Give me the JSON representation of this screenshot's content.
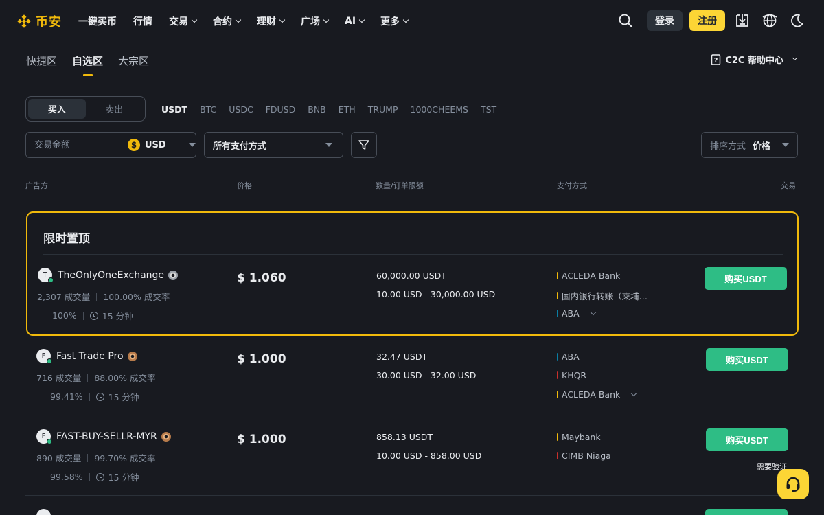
{
  "header": {
    "logo_text": "币安",
    "nav": [
      {
        "label": "一键买币",
        "dropdown": false
      },
      {
        "label": "行情",
        "dropdown": false
      },
      {
        "label": "交易",
        "dropdown": true
      },
      {
        "label": "合约",
        "dropdown": true
      },
      {
        "label": "理财",
        "dropdown": true
      },
      {
        "label": "广场",
        "dropdown": true
      },
      {
        "label": "AI",
        "dropdown": true
      },
      {
        "label": "更多",
        "dropdown": true
      }
    ],
    "login_label": "登录",
    "register_label": "注册",
    "icons": [
      "search-icon",
      "download-icon",
      "globe-icon",
      "moon-icon"
    ]
  },
  "subtabs": [
    "快捷区",
    "自选区",
    "大宗区"
  ],
  "active_subtab": "自选区",
  "help_center": "C2C 帮助中心",
  "trade_toggle": {
    "buy": "买入",
    "sell": "卖出",
    "active": "buy"
  },
  "coins": [
    "USDT",
    "BTC",
    "USDC",
    "FDUSD",
    "BNB",
    "ETH",
    "TRUMP",
    "1000CHEEMS",
    "TST"
  ],
  "active_coin": "USDT",
  "filters": {
    "amount_placeholder": "交易金额",
    "currency_symbol": "$",
    "currency": "USD",
    "payment": "所有支付方式",
    "sort_label": "排序方式",
    "sort_value": "价格"
  },
  "table_headers": {
    "advertiser": "广告方",
    "price": "价格",
    "limit": "数量/订单限额",
    "payment": "支付方式",
    "trade": "交易"
  },
  "promo_title": "限时置顶",
  "ads": [
    {
      "initial": "T",
      "name": "TheOnlyOneExchange",
      "orders": "2,307 成交量",
      "completion": "100.00% 成交率",
      "positive": "100%",
      "time": "15 分钟",
      "price": "$ 1.060",
      "amount": "60,000.00 USDT",
      "limit": "10.00 USD - 30,000.00 USD",
      "payments": [
        {
          "name": "ACLEDA Bank",
          "color": "#f0b90b"
        },
        {
          "name": "国内银行转账（柬埔…",
          "color": "#f0b90b"
        },
        {
          "name": "ABA",
          "color": "#0a7ea4"
        }
      ],
      "button": "购买USDT",
      "verify": ""
    },
    {
      "initial": "F",
      "name": "Fast Trade Pro",
      "orders": "716 成交量",
      "completion": "88.00% 成交率",
      "positive": "99.41%",
      "time": "15 分钟",
      "price": "$ 1.000",
      "amount": "32.47 USDT",
      "limit": "30.00 USD - 32.00 USD",
      "payments": [
        {
          "name": "ABA",
          "color": "#0a7ea4"
        },
        {
          "name": "KHQR",
          "color": "#c9302c"
        },
        {
          "name": "ACLEDA Bank",
          "color": "#f0b90b"
        }
      ],
      "button": "购买USDT",
      "verify": ""
    },
    {
      "initial": "F",
      "name": "FAST-BUY-SELLR-MYR",
      "orders": "890 成交量",
      "completion": "99.70% 成交率",
      "positive": "99.58%",
      "time": "15 分钟",
      "price": "$ 1.000",
      "amount": "858.13 USDT",
      "limit": "10.00 USD - 858.00 USD",
      "payments": [
        {
          "name": "Maybank",
          "color": "#f0b90b"
        },
        {
          "name": "CIMB Niaga",
          "color": "#c9302c"
        }
      ],
      "button": "购买USDT",
      "verify": "需要验证"
    }
  ]
}
